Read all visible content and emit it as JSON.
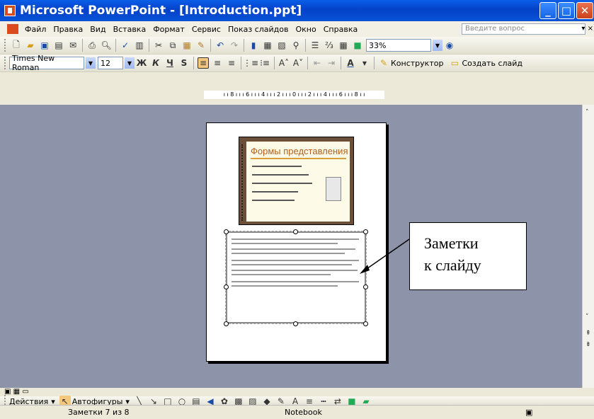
{
  "window": {
    "title": "Microsoft PowerPoint - [Introduction.ppt]"
  },
  "menu": {
    "items": [
      "Файл",
      "Правка",
      "Вид",
      "Вставка",
      "Формат",
      "Сервис",
      "Показ слайдов",
      "Окно",
      "Справка"
    ],
    "ask_placeholder": "Введите вопрос"
  },
  "toolbar": {
    "zoom": "33%"
  },
  "format_toolbar": {
    "font": "Times New Roman",
    "size": "12",
    "bold": "Ж",
    "italic": "К",
    "underline": "Ч",
    "shadow": "S",
    "designer": "Конструктор",
    "new_slide": "Создать слайд"
  },
  "ruler": {
    "text": "ı ı 8 ı ı ı 6 ı ı ı 4 ı ı ı 2 ı ı ı 0 ı ı ı 2 ı ı ı 4 ı ı ı 6 ı ı ı 8 ı ı"
  },
  "slide": {
    "title": "Формы представления"
  },
  "callout": {
    "line1": "Заметки",
    "line2": "к слайду"
  },
  "drawing_toolbar": {
    "actions": "Действия",
    "autoshapes": "Автофигуры"
  },
  "status": {
    "notes": "Заметки 7 из 8",
    "template": "Notebook"
  },
  "colors": {
    "title_bar": "#0a5ee8",
    "workspace": "#8d93a8",
    "slide_frame": "#6b4f38",
    "slide_title": "#b4601c"
  }
}
